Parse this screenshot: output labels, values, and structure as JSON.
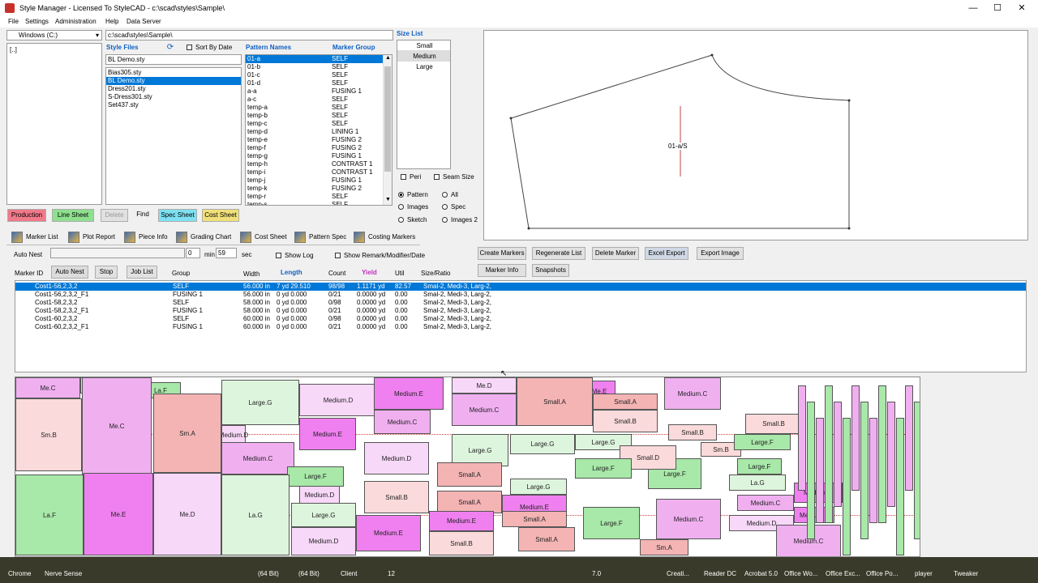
{
  "window": {
    "title": "Style Manager - Licensed To StyleCAD - c:\\scad\\styles\\Sample\\"
  },
  "menu": [
    "File",
    "Settings",
    "Administration",
    "Help",
    "Data Server"
  ],
  "drive": {
    "label": "Windows (C:)",
    "folder": "[..]"
  },
  "path": "c:\\scad\\styles\\Sample\\",
  "style_files": {
    "header": "Style Files",
    "sort_label": "Sort By Date",
    "current": "BL Demo.sty",
    "items": [
      "Bias305.sty",
      "BL Demo.sty",
      "Dress201.sty",
      "S-Dress301.sty",
      "Set437.sty"
    ],
    "selected_index": 1
  },
  "patterns": {
    "col1": "Pattern Names",
    "col2": "Marker Group",
    "rows": [
      [
        "01-a",
        "SELF"
      ],
      [
        "01-b",
        "SELF"
      ],
      [
        "01-c",
        "SELF"
      ],
      [
        "01-d",
        "SELF"
      ],
      [
        "a-a",
        "FUSING 1"
      ],
      [
        "a-c",
        "SELF"
      ],
      [
        "temp-a",
        "SELF"
      ],
      [
        "temp-b",
        "SELF"
      ],
      [
        "temp-c",
        "SELF"
      ],
      [
        "temp-d",
        "LINING 1"
      ],
      [
        "temp-e",
        "FUSING 2"
      ],
      [
        "temp-f",
        "FUSING 2"
      ],
      [
        "temp-g",
        "FUSING 1"
      ],
      [
        "temp-h",
        "CONTRAST 1"
      ],
      [
        "temp-i",
        "CONTRAST 1"
      ],
      [
        "temp-j",
        "FUSING 1"
      ],
      [
        "temp-k",
        "FUSING 2"
      ],
      [
        "temp-r",
        "SELF"
      ],
      [
        "temp-s",
        "SELF"
      ]
    ]
  },
  "size_list": {
    "header": "Size List",
    "items": [
      "Small",
      "Medium",
      "Large"
    ],
    "selected_index": 1
  },
  "view_options": {
    "peri": "Peri",
    "seam_size": "Seam Size",
    "radios": [
      "Pattern",
      "All",
      "Images",
      "Spec",
      "Sketch",
      "Images 2"
    ]
  },
  "preview": {
    "piece_label": "01-a/S"
  },
  "sheet_buttons": {
    "production": "Production",
    "line_sheet": "Line Sheet",
    "delete": "Delete",
    "find": "Find",
    "spec_sheet": "Spec Sheet",
    "cost_sheet": "Cost Sheet"
  },
  "toolbar": [
    "Marker List",
    "Plot Report",
    "Piece Info",
    "Grading Chart",
    "Cost Sheet",
    "Pattern Spec",
    "Costing Markers"
  ],
  "colors": {
    "production": "#f07a8a",
    "line_sheet": "#8ee08e",
    "spec_sheet": "#7ee0f0",
    "cost_sheet": "#f0e07a",
    "selection": "#0078d7"
  },
  "auto_nest": {
    "label": "Auto Nest",
    "min_value": "0",
    "min_label": "min",
    "sec_value": "59",
    "sec_label": "sec",
    "show_log": "Show Log",
    "show_remark": "Show Remark/Modifier/Date"
  },
  "action_buttons": [
    "Create Markers",
    "Regenerate List",
    "Delete Marker",
    "Excel Export",
    "Export Image",
    "Marker Info",
    "Snapshots"
  ],
  "marker_controls": {
    "marker_id": "Marker ID",
    "auto_nest": "Auto Nest",
    "stop": "Stop",
    "job_list": "Job List"
  },
  "results": {
    "headers": [
      "Group",
      "Width",
      "Length",
      "Count",
      "Yield",
      "Util",
      "Size/Ratio"
    ],
    "rows": [
      [
        "Cost1-56,2,3,2",
        "SELF",
        "56.000 in",
        "7 yd 29.510",
        "98/98",
        "1.1171 yd",
        "82.57",
        "Smal-2, Medi-3, Larg-2,"
      ],
      [
        "Cost1-56,2,3,2_F1",
        "FUSING 1",
        "56.000 in",
        "0 yd 0.000",
        "0/21",
        "0.0000 yd",
        "0.00",
        "Smal-2, Medi-3, Larg-2,"
      ],
      [
        "Cost1-58,2,3,2",
        "SELF",
        "58.000 in",
        "0 yd 0.000",
        "0/98",
        "0.0000 yd",
        "0.00",
        "Smal-2, Medi-3, Larg-2,"
      ],
      [
        "Cost1-58,2,3,2_F1",
        "FUSING 1",
        "58.000 in",
        "0 yd 0.000",
        "0/21",
        "0.0000 yd",
        "0.00",
        "Smal-2, Medi-3, Larg-2,"
      ],
      [
        "Cost1-60,2,3,2",
        "SELF",
        "60.000 in",
        "0 yd 0.000",
        "0/98",
        "0.0000 yd",
        "0.00",
        "Smal-2, Medi-3, Larg-2,"
      ],
      [
        "Cost1-60,2,3,2_F1",
        "FUSING 1",
        "60.000 in",
        "0 yd 0.000",
        "0/21",
        "0.0000 yd",
        "0.00",
        "Smal-2, Medi-3, Larg-2,"
      ]
    ],
    "selected_index": 0
  },
  "marker_pieces": [
    "Me.C",
    "Small.B",
    "La.F",
    "Sm.B",
    "Large.G",
    "Medium.D",
    "Medium.E",
    "Me.D",
    "Me.E",
    "Medium.C",
    "Medium.C",
    "Medium.D",
    "Small.A",
    "Large.G",
    "Small.A",
    "Small.B",
    "Medium.E",
    "Medium.C",
    "Medium.C",
    "Me.C",
    "Sm.A",
    "Large.G",
    "Medium.D",
    "Large.G",
    "Large.F",
    "Small.D",
    "Large.F",
    "Sm.B",
    "Large.F",
    "Small.A",
    "Large.F",
    "Small.B",
    "La.F",
    "Medium.D",
    "Small.B",
    "Large.G",
    "Medium.E",
    "Small.A",
    "Medium.C",
    "Large.G",
    "Medium.E",
    "Me.E",
    "Me.D",
    "La.G",
    "Medium.D",
    "Medium.E",
    "Small.B",
    "Small.A",
    "Large.F",
    "Medium.E",
    "Medium.D",
    "Medium.C",
    "Sm.A",
    "Small.B",
    "Large.F",
    "La.G",
    "Medium.C",
    "Small.A",
    "Medium.E"
  ],
  "taskbar": [
    "Chrome",
    "Nerve Sense",
    "(64 Bit)",
    "(64 Bit)",
    "Client",
    "12",
    "7.0",
    "Creati...",
    "Reader DC",
    "Acrobat 5.0",
    "Office Wo...",
    "Office Exc...",
    "Office Po...",
    "player",
    "Tweaker"
  ]
}
